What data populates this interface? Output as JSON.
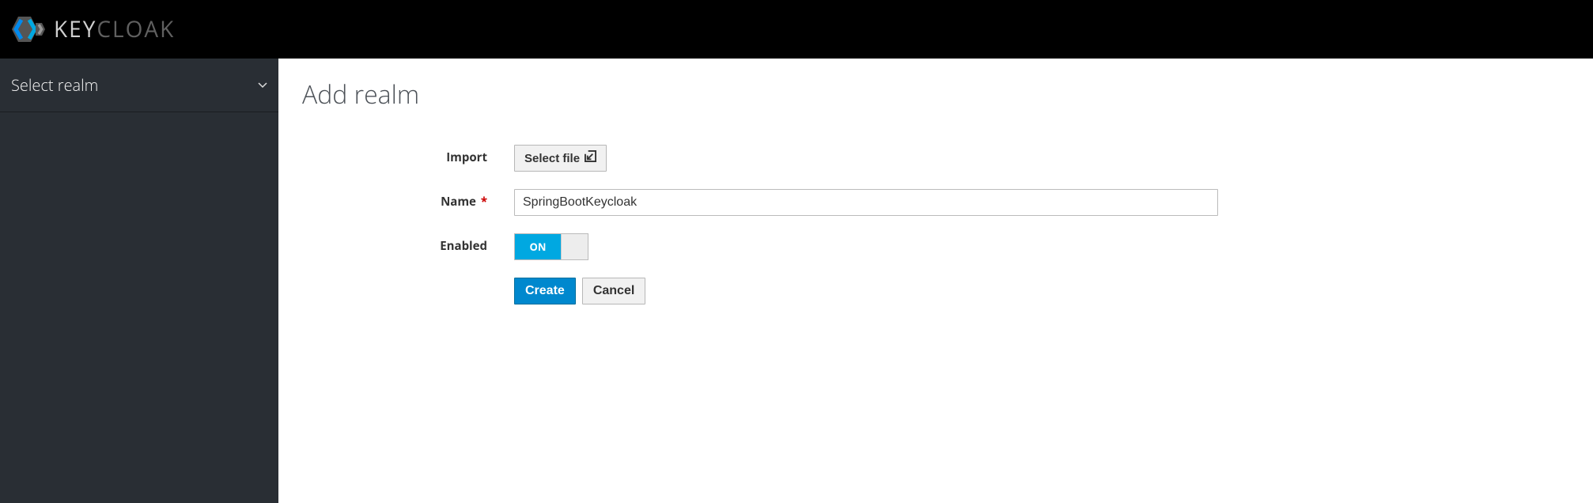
{
  "brand": {
    "key": "KEY",
    "cloak": "CLOAK"
  },
  "sidebar": {
    "selector_label": "Select realm"
  },
  "page": {
    "title": "Add realm"
  },
  "form": {
    "import_label": "Import",
    "select_file_label": "Select file",
    "name_label": "Name",
    "name_value": "SpringBootKeycloak",
    "enabled_label": "Enabled",
    "toggle_on_label": "ON",
    "create_label": "Create",
    "cancel_label": "Cancel"
  }
}
